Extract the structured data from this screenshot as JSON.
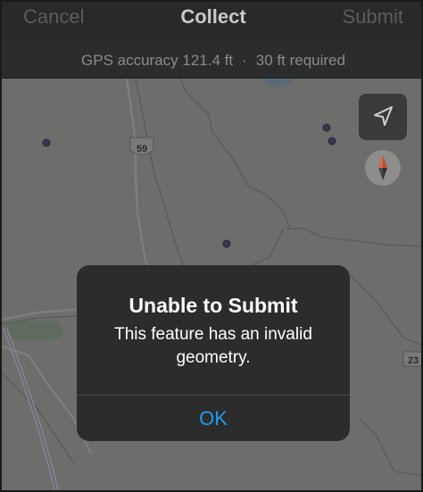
{
  "navbar": {
    "cancel_label": "Cancel",
    "title": "Collect",
    "submit_label": "Submit"
  },
  "gps": {
    "accuracy": "GPS accuracy 121.4 ft",
    "separator": "·",
    "required": "30 ft required"
  },
  "map": {
    "route_59": "59",
    "route_23": "23",
    "locate_icon": "location-arrow-icon",
    "compass_icon": "compass-icon"
  },
  "alert": {
    "title": "Unable to Submit",
    "message": "This feature has an invalid geometry.",
    "ok_label": "OK"
  },
  "colors": {
    "accent": "#1e9bf0",
    "dialog_bg": "#2c2c2c",
    "navbar_bg": "#292929",
    "map_bg": "#6d6d6b",
    "point": "#3b3550"
  }
}
